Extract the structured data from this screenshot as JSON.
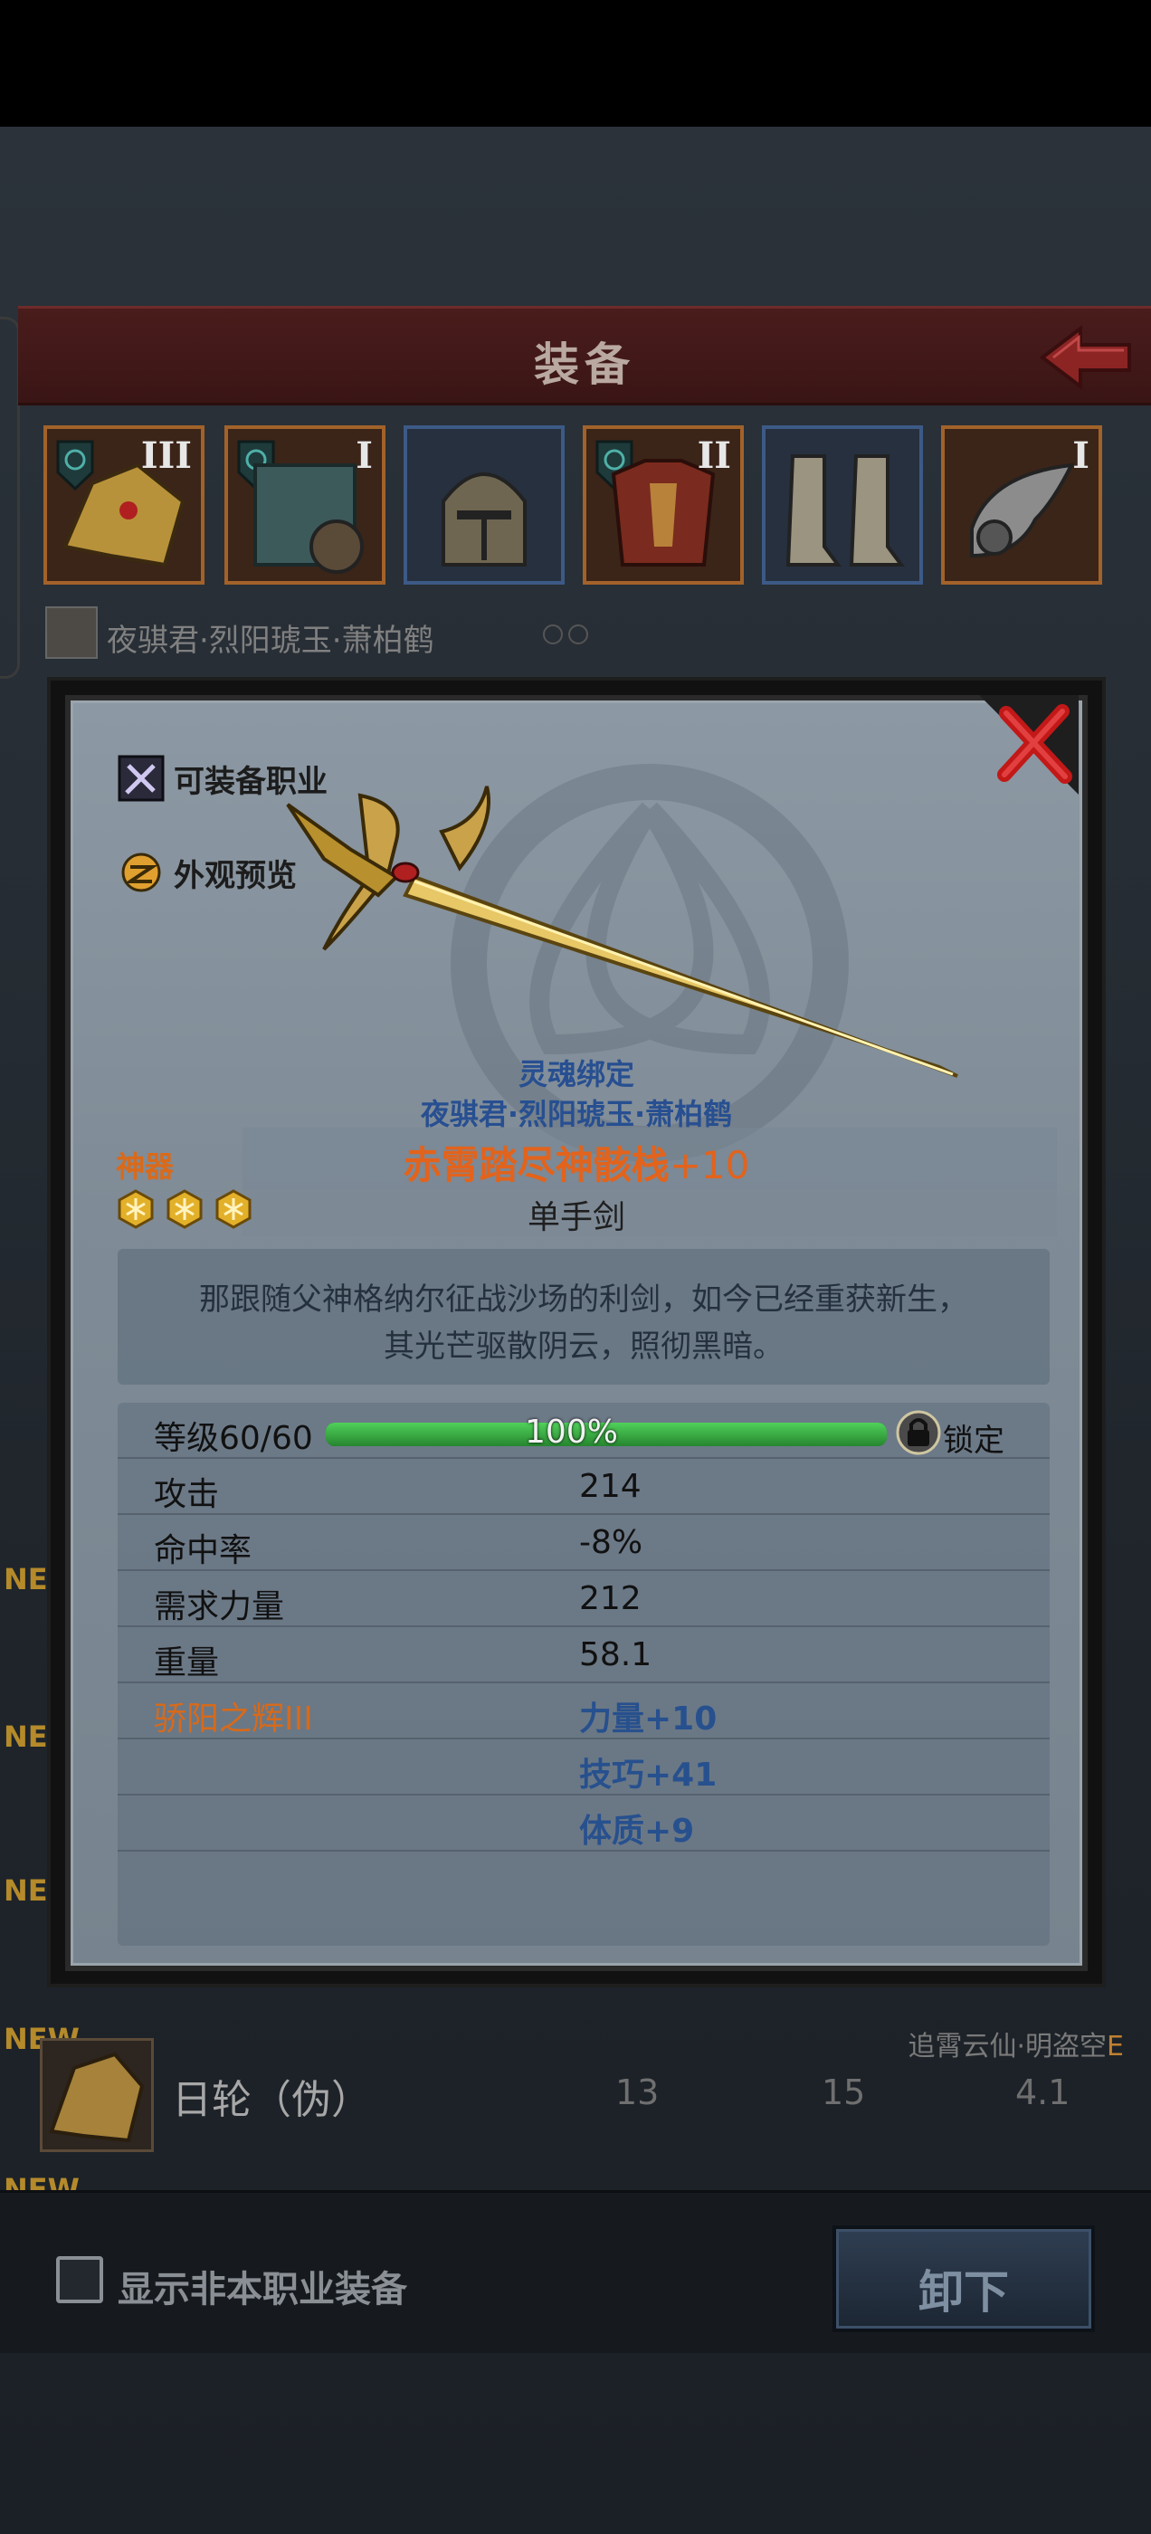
{
  "header": {
    "title": "装备"
  },
  "slots": [
    {
      "tier": "III",
      "frame": "orange",
      "has_gem": true,
      "icon": "shoulder-armor-icon"
    },
    {
      "tier": "I",
      "frame": "orange",
      "has_gem": true,
      "icon": "shield-icon"
    },
    {
      "tier": "",
      "frame": "blue",
      "has_gem": false,
      "icon": "helmet-icon"
    },
    {
      "tier": "II",
      "frame": "orange",
      "has_gem": true,
      "icon": "chest-armor-icon"
    },
    {
      "tier": "",
      "frame": "blue",
      "has_gem": false,
      "icon": "boots-icon"
    },
    {
      "tier": "I",
      "frame": "orange",
      "has_gem": false,
      "icon": "bracer-icon"
    }
  ],
  "owner": {
    "name": "夜骐君·烈阳琥玉·萧柏鹤"
  },
  "modal": {
    "options": [
      {
        "label": "可装备职业",
        "icon": "class-icon"
      },
      {
        "label": "外观预览",
        "icon": "appearance-icon"
      }
    ],
    "soul_bound": "灵魂绑定",
    "bound_owner": "夜骐君·烈阳琥玉·萧柏鹤",
    "rarity": "神器",
    "item_name": "赤霄踏尽神骸栈",
    "item_plus": "+10",
    "stars": 3,
    "item_type": "单手剑",
    "description_line1": "那跟随父神格纳尔征战沙场的利剑，如今已经重获新生，",
    "description_line2": "其光芒驱散阴云，照彻黑暗。",
    "level": {
      "label": "等级60/60",
      "progress": 1.0,
      "percent_text": "100%",
      "lock_label": "锁定"
    },
    "stats": [
      {
        "key": "攻击",
        "value": "214"
      },
      {
        "key": "命中率",
        "value": "-8%"
      },
      {
        "key": "需求力量",
        "value": "212"
      },
      {
        "key": "重量",
        "value": "58.1"
      }
    ],
    "set_bonus": {
      "name": "骄阳之辉III",
      "values": [
        "力量+10",
        "技巧+41",
        "体质+9"
      ]
    }
  },
  "list": {
    "new_tags": [
      "NEW",
      "NEW",
      "NEW",
      "NEW",
      "NEW"
    ],
    "item": {
      "name": "日轮（伪）",
      "num1": "13",
      "num2": "15",
      "num3": "4.1",
      "owner": "追霄云仙·明盗空",
      "owner_suffix": "E"
    }
  },
  "footer": {
    "checkbox_label": "显示非本职业装备",
    "unequip_label": "卸下"
  },
  "colors": {
    "rarity_orange": "#e2631c",
    "soul_blue": "#274f91",
    "level_green": "#2f9e3a"
  }
}
